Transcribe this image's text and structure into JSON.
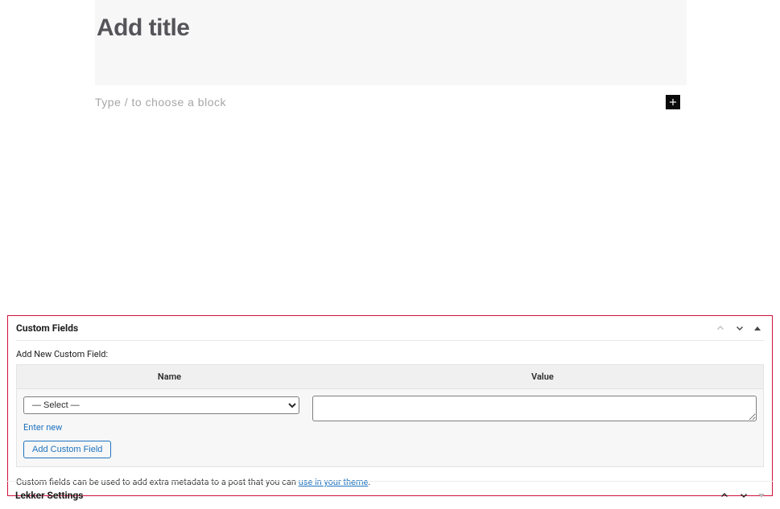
{
  "editor": {
    "title_placeholder": "Add title",
    "block_chooser_text": "Type / to choose a block"
  },
  "custom_fields": {
    "panel_title": "Custom Fields",
    "add_new_label": "Add New Custom Field:",
    "columns": {
      "name": "Name",
      "value": "Value"
    },
    "select_placeholder": "— Select —",
    "enter_new": "Enter new",
    "add_button": "Add Custom Field",
    "help_prefix": "Custom fields can be used to add extra metadata to a post that you can ",
    "help_link": "use in your theme",
    "help_suffix": "."
  },
  "lekker": {
    "panel_title": "Lekker Settings"
  }
}
